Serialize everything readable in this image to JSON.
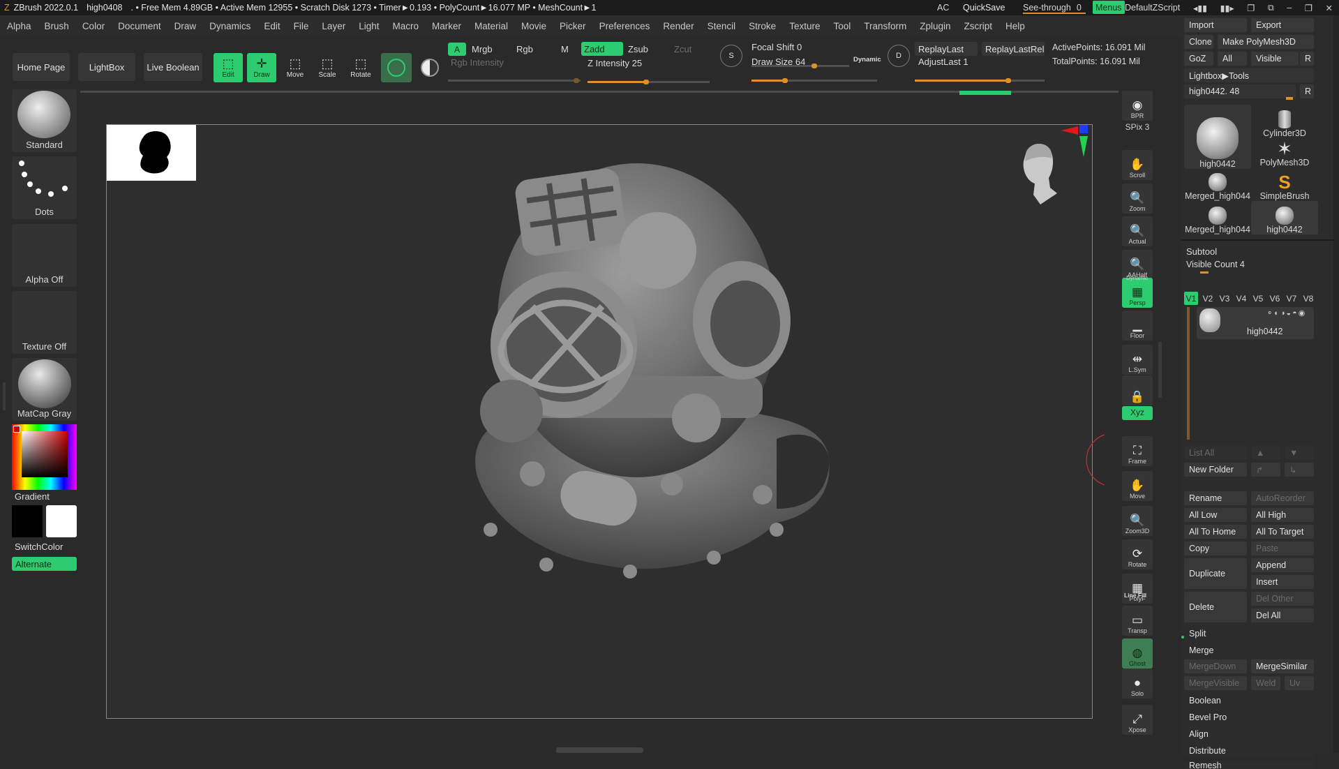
{
  "titlebar": {
    "app": "ZBrush 2022.0.1",
    "doc": "high0408",
    "stats": ". • Free Mem 4.89GB • Active Mem 12955 • Scratch Disk 1273 • Timer►0.193 • PolyCount►16.077 MP • MeshCount►1",
    "ac": "AC",
    "quicksave": "QuickSave",
    "seethrough": "See-through",
    "seethrough_val": "0",
    "menus": "Menus",
    "defaultzscript": "DefaultZScript"
  },
  "menubar": [
    "Alpha",
    "Brush",
    "Color",
    "Document",
    "Draw",
    "Dynamics",
    "Edit",
    "File",
    "Layer",
    "Light",
    "Macro",
    "Marker",
    "Material",
    "Movie",
    "Picker",
    "Preferences",
    "Render",
    "Stencil",
    "Stroke",
    "Texture",
    "Tool",
    "Transform",
    "Zplugin",
    "Zscript",
    "Help"
  ],
  "toolbar": {
    "home": "Home Page",
    "lightbox": "LightBox",
    "liveboolean": "Live Boolean",
    "edit": "Edit",
    "draw": "Draw",
    "move": "Move",
    "scale": "Scale",
    "rotate": "Rotate",
    "a": "A",
    "mrgb": "Mrgb",
    "rgb": "Rgb",
    "m": "M",
    "rgb_intensity": "Rgb Intensity",
    "zadd": "Zadd",
    "zsub": "Zsub",
    "zcut": "Zcut",
    "z_intensity": "Z Intensity",
    "z_intensity_val": "25",
    "focal_shift": "Focal Shift",
    "focal_shift_val": "0",
    "draw_size": "Draw Size",
    "draw_size_val": "64",
    "dynamic": "Dynamic",
    "replaylast": "ReplayLast",
    "replaylastrel": "ReplayLastRel",
    "adjustlast": "AdjustLast",
    "adjustlast_val": "1",
    "activepoints": "ActivePoints: 16.091 Mil",
    "totalpoints": "TotalPoints: 16.091 Mil",
    "s": "S",
    "d": "D"
  },
  "leftshelf": {
    "standard": "Standard",
    "dots": "Dots",
    "alpha": "Alpha Off",
    "texture": "Texture Off",
    "matcap": "MatCap Gray",
    "gradient": "Gradient",
    "switchcolor": "SwitchColor",
    "alternate": "Alternate"
  },
  "rightshelf": [
    {
      "n": "bpr",
      "label": "BPR",
      "icon": "◉"
    },
    {
      "n": "spix",
      "label": "SPix 3",
      "icon": ""
    },
    {
      "n": "scroll",
      "label": "Scroll",
      "icon": "✋"
    },
    {
      "n": "zoom",
      "label": "Zoom",
      "icon": "🔍"
    },
    {
      "n": "actual",
      "label": "Actual",
      "icon": "🔍"
    },
    {
      "n": "aahalf",
      "label": "AAHalf",
      "icon": "🔍"
    },
    {
      "n": "persp",
      "label": "Persp",
      "icon": "▦"
    },
    {
      "n": "floor",
      "label": "Floor",
      "icon": "▁"
    },
    {
      "n": "lsym",
      "label": "L.Sym",
      "icon": "⇹"
    },
    {
      "n": "lock",
      "label": "",
      "icon": "🔒"
    },
    {
      "n": "xyz",
      "label": "Xyz",
      "icon": ""
    },
    {
      "n": "frame",
      "label": "Frame",
      "icon": "⛶"
    },
    {
      "n": "move",
      "label": "Move",
      "icon": "✋"
    },
    {
      "n": "zoom3d",
      "label": "Zoom3D",
      "icon": "🔍"
    },
    {
      "n": "rotate",
      "label": "Rotate",
      "icon": "⟳"
    },
    {
      "n": "polyf",
      "label": "PolyF",
      "icon": "▦"
    },
    {
      "n": "transp",
      "label": "Transp",
      "icon": "▭"
    },
    {
      "n": "ghost",
      "label": "Ghost",
      "icon": "◍"
    },
    {
      "n": "solo",
      "label": "Solo",
      "icon": "●"
    },
    {
      "n": "xpose",
      "label": "Xpose",
      "icon": "⤢"
    }
  ],
  "rightshelf_extra": {
    "dynamic": "Dynamic",
    "linefill": "Line Fill"
  },
  "panel": {
    "import": "Import",
    "export": "Export",
    "clone": "Clone",
    "make_polymesh": "Make PolyMesh3D",
    "goz": "GoZ",
    "all": "All",
    "visible": "Visible",
    "r": "R",
    "lightbox_tools": "Lightbox▶Tools",
    "tool_name": "high0442.",
    "tool_val": "48",
    "tools": [
      "high0442",
      "Cylinder3D",
      "PolyMesh3D",
      "Merged_high044",
      "SimpleBrush",
      "Merged_high044",
      "high0442"
    ],
    "subtool": "Subtool",
    "visible_count": "Visible Count 4",
    "vtabs": [
      "V1",
      "V2",
      "V3",
      "V4",
      "V5",
      "V6",
      "V7",
      "V8"
    ],
    "subtool_item": "high0442",
    "list_all": "List All",
    "new_folder": "New Folder",
    "rename": "Rename",
    "autoreorder": "AutoReorder",
    "all_low": "All Low",
    "all_high": "All High",
    "all_to_home": "All To Home",
    "all_to_target": "All To Target",
    "copy": "Copy",
    "paste": "Paste",
    "duplicate": "Duplicate",
    "append": "Append",
    "insert": "Insert",
    "delete": "Delete",
    "del_other": "Del Other",
    "del_all": "Del All",
    "split": "Split",
    "merge": "Merge",
    "mergedown": "MergeDown",
    "mergesimilar": "MergeSimilar",
    "mergevisible": "MergeVisible",
    "weld": "Weld",
    "uv": "Uv",
    "boolean": "Boolean",
    "bevel_pro": "Bevel Pro",
    "align": "Align",
    "distribute": "Distribute",
    "remesh": "Remesh"
  },
  "colors": {
    "green": "#2ecc71",
    "orange": "#e0902b",
    "bg": "#2a2a2a"
  }
}
